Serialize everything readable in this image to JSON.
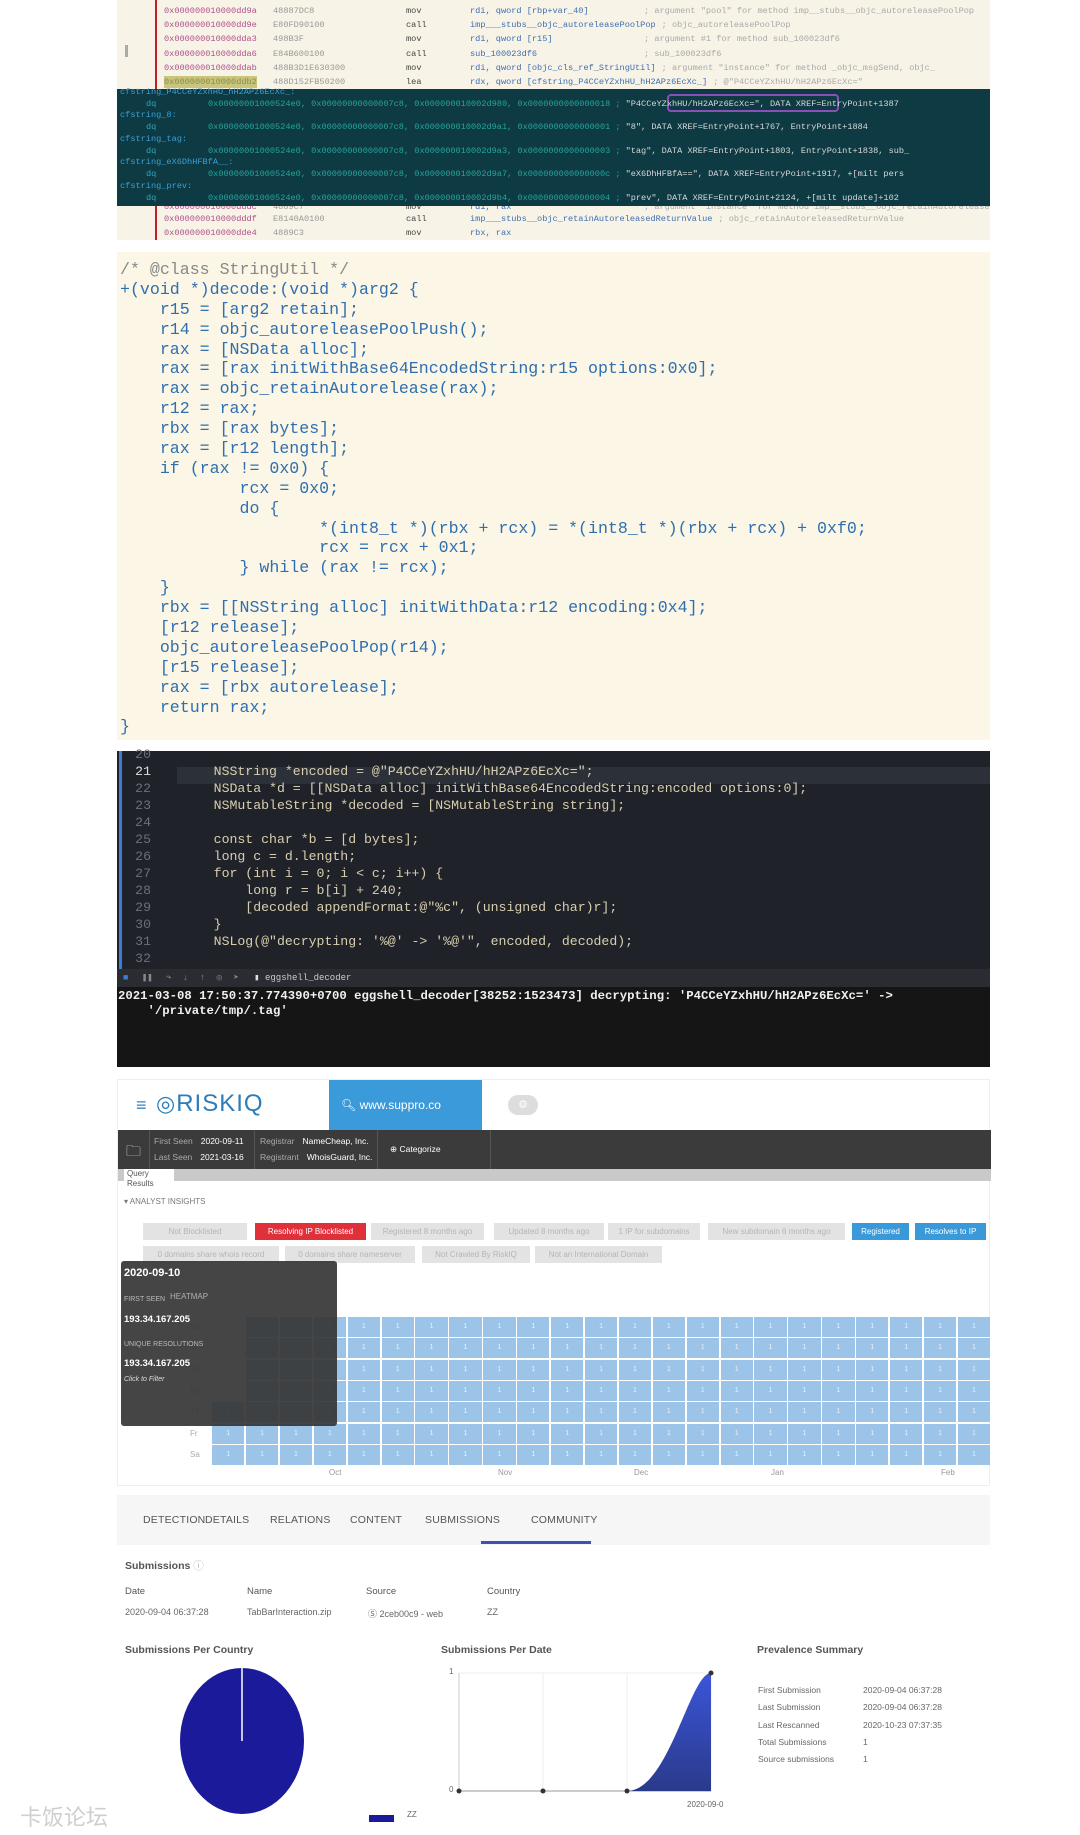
{
  "disassembly": {
    "rows_top": [
      {
        "addr": "0x000000010000dd9a",
        "bytes": "48887DC8",
        "mnem": "mov",
        "ops": "rdi, qword [rbp+var_40]",
        "comment": "; argument \"pool\" for method imp__stubs__objc_autoreleasePoolPop"
      },
      {
        "addr": "0x000000010000dd9e",
        "bytes": "E80FD90100",
        "mnem": "call",
        "ops": "imp___stubs__objc_autoreleasePoolPop",
        "comment": "; objc_autoreleasePoolPop"
      },
      {
        "addr": "0x000000010000dda3",
        "bytes": "498B3F",
        "mnem": "mov",
        "ops": "rdi, qword [r15]",
        "comment": "; argument #1 for method sub_100023df6"
      },
      {
        "addr": "0x000000010000dda6",
        "bytes": "E84B600100",
        "mnem": "call",
        "ops": "sub_100023df6",
        "comment": "; sub_100023df6"
      },
      {
        "addr": "0x000000010000ddab",
        "bytes": "488B3D1E630300",
        "mnem": "mov",
        "ops": "rdi, qword [objc_cls_ref_StringUtil]",
        "comment": "; argument \"instance\" for method _objc_msgSend, objc_"
      },
      {
        "addr": "0x000000010000ddb2",
        "bytes": "488D152FB50200",
        "mnem": "lea",
        "ops": "rdx, qword [cfstring_P4CCeYZxhHU_hH2APz6EcXc_]",
        "comment": "; @\"P4CCeYZxhHU/hH2APz6EcXc=\""
      }
    ],
    "rows_bottom": [
      {
        "addr": "0x000000010000dddc",
        "bytes": "4889C7",
        "mnem": "mov",
        "ops": "rdi, rax",
        "comment": "; argument \"instance\" for method imp__stubs__objc_retainAutoreleasedReturnValue"
      },
      {
        "addr": "0x000000010000dddf",
        "bytes": "E8140A0100",
        "mnem": "call",
        "ops": "imp___stubs__objc_retainAutoreleasedReturnValue",
        "comment": "; objc_retainAutoreleasedReturnValue"
      },
      {
        "addr": "0x000000010000dde4",
        "bytes": "4889C3",
        "mnem": "mov",
        "ops": "rbx, rax",
        "comment": ""
      }
    ],
    "cfstrings": [
      {
        "label": "cfstring_P4CCeYZxhHU_hH2APz6EcXc_:",
        "dq": "dq",
        "hex": "0x00000001000524e0, 0x00000000000007c8, 0x000000010002d980, 0x0000000000000018 ;",
        "str": "\"P4CCeYZxhHU/hH2APz6EcXc=\", DATA XREF=EntryPoint+1387"
      },
      {
        "label": "cfstring_8:",
        "dq": "dq",
        "hex": "0x00000001000524e0, 0x00000000000007c8, 0x000000010002d9a1, 0x0000000000000001 ;",
        "str": "\"8\", DATA XREF=EntryPoint+1767, EntryPoint+1884"
      },
      {
        "label": "cfstring_tag:",
        "dq": "dq",
        "hex": "0x00000001000524e0, 0x00000000000007c8, 0x000000010002d9a3, 0x0000000000000003 ;",
        "str": "\"tag\", DATA XREF=EntryPoint+1803, EntryPoint+1838, sub_"
      },
      {
        "label": "cfstring_eX6DhHFBfA__:",
        "dq": "dq",
        "hex": "0x00000001000524e0, 0x00000000000007c8, 0x000000010002d9a7, 0x000000000000000c ;",
        "str": "\"eX6DhHFBfA==\", DATA XREF=EntryPoint+1917, +[milt pers"
      },
      {
        "label": "cfstring_prev:",
        "dq": "dq",
        "hex": "0x00000001000524e0, 0x00000000000007c8, 0x000000010002d9b4, 0x0000000000000004 ;",
        "str": "\"prev\", DATA XREF=EntryPoint+2124, +[milt update]+102"
      }
    ]
  },
  "pseudocode": {
    "lines": [
      "/* @class StringUtil */",
      "+(void *)decode:(void *)arg2 {",
      "    r15 = [arg2 retain];",
      "    r14 = objc_autoreleasePoolPush();",
      "    rax = [NSData alloc];",
      "    rax = [rax initWithBase64EncodedString:r15 options:0x0];",
      "    rax = objc_retainAutorelease(rax);",
      "    r12 = rax;",
      "    rbx = [rax bytes];",
      "    rax = [r12 length];",
      "    if (rax != 0x0) {",
      "            rcx = 0x0;",
      "            do {",
      "                    *(int8_t *)(rbx + rcx) = *(int8_t *)(rbx + rcx) + 0xf0;",
      "                    rcx = rcx + 0x1;",
      "            } while (rax != rcx);",
      "    }",
      "    rbx = [[NSString alloc] initWithData:r12 encoding:0x4];",
      "    [r12 release];",
      "    objc_autoreleasePoolPop(r14);",
      "    [r15 release];",
      "    rax = [rbx autorelease];",
      "    return rax;",
      "}"
    ]
  },
  "xcode": {
    "current_line": "21",
    "lines": [
      {
        "n": "20",
        "code": ""
      },
      {
        "n": "21",
        "code": "    NSString *encoded = @\"P4CCeYZxhHU/hH2APz6EcXc=\";"
      },
      {
        "n": "22",
        "code": "    NSData *d = [[NSData alloc] initWithBase64EncodedString:encoded options:0];"
      },
      {
        "n": "23",
        "code": "    NSMutableString *decoded = [NSMutableString string];"
      },
      {
        "n": "24",
        "code": ""
      },
      {
        "n": "25",
        "code": "    const char *b = [d bytes];"
      },
      {
        "n": "26",
        "code": "    long c = d.length;"
      },
      {
        "n": "27",
        "code": "    for (int i = 0; i < c; i++) {"
      },
      {
        "n": "28",
        "code": "        long r = b[i] + 240;"
      },
      {
        "n": "29",
        "code": "        [decoded appendFormat:@\"%c\", (unsigned char)r];"
      },
      {
        "n": "30",
        "code": "    }"
      },
      {
        "n": "31",
        "code": "    NSLog(@\"decrypting: '%@' -> '%@'\", encoded, decoded);"
      },
      {
        "n": "32",
        "code": ""
      }
    ],
    "debug_target": "eggshell_decoder",
    "console": [
      "2021-03-08 17:50:37.774390+0700 eggshell_decoder[38252:1523473] decrypting: 'P4CCeYZxhHU/hH2APz6EcXc=' ->",
      "    '/private/tmp/.tag'"
    ]
  },
  "riskiq": {
    "logo": "RISKIQ",
    "search": "www.suppro.co",
    "first_seen_label": "First Seen",
    "first_seen": "2020-09-11",
    "last_seen_label": "Last Seen",
    "last_seen": "2021-03-16",
    "registrar_label": "Registrar",
    "registrar": "NameCheap, Inc.",
    "registrant_label": "Registrant",
    "registrant": "WhoisGuard, Inc.",
    "categorize": "Categorize",
    "query_results": "Query Results",
    "analyst_insights": "ANALYST INSIGHTS",
    "tags_row1": [
      {
        "label": "Not Blocklisted",
        "style": "grey"
      },
      {
        "label": "Resolving IP Blocklisted",
        "style": "red"
      },
      {
        "label": "Registered 8 months ago",
        "style": "grey"
      },
      {
        "label": "Updated 8 months ago",
        "style": "grey"
      },
      {
        "label": "1 IP for subdomains",
        "style": "grey"
      },
      {
        "label": "New subdomain 6 months ago",
        "style": "grey"
      },
      {
        "label": "Registered",
        "style": "blue"
      },
      {
        "label": "Resolves to IP",
        "style": "blue"
      }
    ],
    "tags_row2": [
      {
        "label": "0 domains share whois record",
        "style": "grey"
      },
      {
        "label": "0 domains share nameserver",
        "style": "grey"
      },
      {
        "label": "Not Crawled By RiskIQ",
        "style": "grey"
      },
      {
        "label": "Not an International Domain",
        "style": "grey"
      }
    ],
    "heatmap": {
      "title": "HEATMAP",
      "day_labels": [
        "Su",
        "Mo",
        "Tu",
        "We",
        "Th",
        "Fr",
        "Sa"
      ],
      "month_labels": [
        "Oct",
        "Nov",
        "Dec",
        "Jan",
        "Feb"
      ],
      "cell_value": "1",
      "weeks": 23,
      "first_day": "Th",
      "cell_color": "#9cc3e8"
    },
    "tooltip": {
      "date": "2020-09-10",
      "first_seen_label": "FIRST SEEN",
      "first_seen": "193.34.167.205",
      "unique_label": "UNIQUE RESOLUTIONS",
      "unique": "193.34.167.205",
      "hint": "Click to Filter"
    }
  },
  "virustotal": {
    "tabs": [
      "DETECTION",
      "DETAILS",
      "RELATIONS",
      "CONTENT",
      "SUBMISSIONS",
      "COMMUNITY"
    ],
    "active_tab": "SUBMISSIONS",
    "accent": "#3f51b5",
    "submissions_title": "Submissions",
    "table": {
      "headers": [
        "Date",
        "Name",
        "Source",
        "Country"
      ],
      "row": [
        "2020-09-04 06:37:28",
        "TabBarInteraction.zip",
        "2ceb00c9 - web",
        "ZZ"
      ]
    },
    "per_country": {
      "title": "Submissions Per Country",
      "type": "pie",
      "slices": [
        {
          "label": "ZZ",
          "value": 100,
          "color": "#1a1a9a"
        }
      ]
    },
    "per_date": {
      "title": "Submissions Per Date",
      "type": "area",
      "y_ticks": [
        "1",
        "0"
      ],
      "ylim": [
        0,
        1
      ],
      "values": [
        0,
        0,
        0,
        1
      ],
      "x_label": "2020-09-0",
      "color": "#3b55d9"
    },
    "prevalence": {
      "title": "Prevalence Summary",
      "rows": [
        {
          "k": "First Submission",
          "v": "2020-09-04 06:37:28"
        },
        {
          "k": "Last Submission",
          "v": "2020-09-04 06:37:28"
        },
        {
          "k": "Last Rescanned",
          "v": "2020-10-23 07:37:35"
        },
        {
          "k": "Total Submissions",
          "v": "1"
        },
        {
          "k": "Source submissions",
          "v": "1"
        }
      ]
    }
  },
  "watermark": "卡饭论坛"
}
